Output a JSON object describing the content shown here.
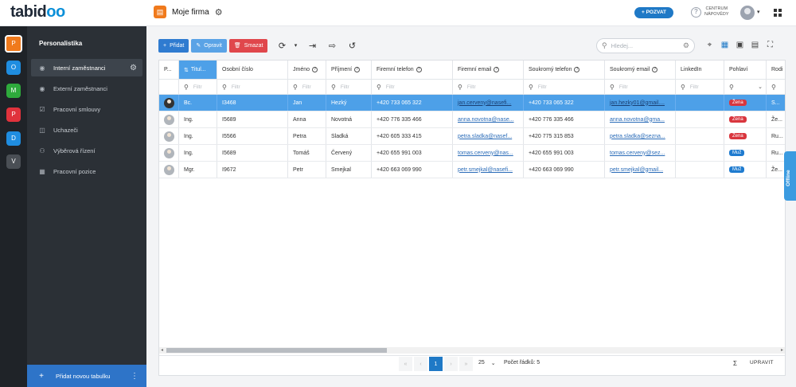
{
  "app": {
    "logo_text": "tabidoo",
    "company": "Moje firma",
    "invite_label": "+ POZVAT",
    "help_line1": "CENTRUM",
    "help_line2": "NÁPOVĚDY",
    "offline_label": "Offline"
  },
  "modules": [
    {
      "letter": "P",
      "color": "#f07a1c"
    },
    {
      "letter": "O",
      "color": "#1f8de0"
    },
    {
      "letter": "M",
      "color": "#2eaa3c"
    },
    {
      "letter": "P",
      "color": "#e0323c"
    },
    {
      "letter": "D",
      "color": "#1f8de0"
    },
    {
      "letter": "V",
      "color": "#4a4f55"
    }
  ],
  "sidebar": {
    "title": "Personalistika",
    "items": [
      {
        "label": "Interní zaměstnanci"
      },
      {
        "label": "Externí zaměstnanci"
      },
      {
        "label": "Pracovní smlouvy"
      },
      {
        "label": "Uchazeči"
      },
      {
        "label": "Výběrová řízení"
      },
      {
        "label": "Pracovní pozice"
      }
    ],
    "add_table": "Přidat novou tabulku"
  },
  "toolbar": {
    "add": "Přidat",
    "edit": "Opravit",
    "delete": "Smazat"
  },
  "search": {
    "placeholder": "Hledej..."
  },
  "table": {
    "columns": [
      "P...",
      "Titul...",
      "Osobní číslo",
      "Jméno",
      "Příjmení",
      "Firemní telefon",
      "Firemní email",
      "Soukromý telefon",
      "Soukromý email",
      "LinkedIn",
      "Pohlaví",
      "Rodi"
    ],
    "filter_placeholder": "Filtr",
    "rows": [
      {
        "title": "Bc.",
        "id": "I3468",
        "first": "Jan",
        "last": "Hezký",
        "phone": "+420 733 065 322",
        "email": "jan.cerveny@nasefi...",
        "pphone": "+420 733 065 322",
        "pemail": "jan.hezky01@gmail....",
        "linkedin": "",
        "gender": "Žena",
        "gender_type": "f",
        "rod": "S..."
      },
      {
        "title": "Ing.",
        "id": "I5689",
        "first": "Anna",
        "last": "Novotná",
        "phone": "+420 776 335 466",
        "email": "anna.novotna@nase...",
        "pphone": "+420 776 335 466",
        "pemail": "anna.novotna@gma...",
        "linkedin": "",
        "gender": "Žena",
        "gender_type": "f",
        "rod": "Že..."
      },
      {
        "title": "Ing.",
        "id": "I5566",
        "first": "Petra",
        "last": "Sladká",
        "phone": "+420 605 333 415",
        "email": "petra.sladka@nasef...",
        "pphone": "+420 775 315 853",
        "pemail": "petra.sladka@sezna...",
        "linkedin": "",
        "gender": "Žena",
        "gender_type": "f",
        "rod": "Ru..."
      },
      {
        "title": "Ing.",
        "id": "I5689",
        "first": "Tomáš",
        "last": "Červený",
        "phone": "+420 655 991 003",
        "email": "tomas.cerveny@nas...",
        "pphone": "+420 655 991 003",
        "pemail": "tomas.cerveny@sez...",
        "linkedin": "",
        "gender": "Muž",
        "gender_type": "m",
        "rod": "Ru..."
      },
      {
        "title": "Mgr.",
        "id": "I9672",
        "first": "Petr",
        "last": "Smejkal",
        "phone": "+420 663 069 990",
        "email": "petr.smejkal@nasefi...",
        "pphone": "+420 663 069 990",
        "pemail": "petr.smejkal@gmail...",
        "linkedin": "",
        "gender": "Muž",
        "gender_type": "m",
        "rod": "Že..."
      }
    ]
  },
  "pager": {
    "first": "«",
    "prev": "‹",
    "page": "1",
    "next": "›",
    "last": "»",
    "size": "25",
    "count": "Počet řádků: 5",
    "sum": "Σ",
    "edit": "UPRAVIT"
  }
}
